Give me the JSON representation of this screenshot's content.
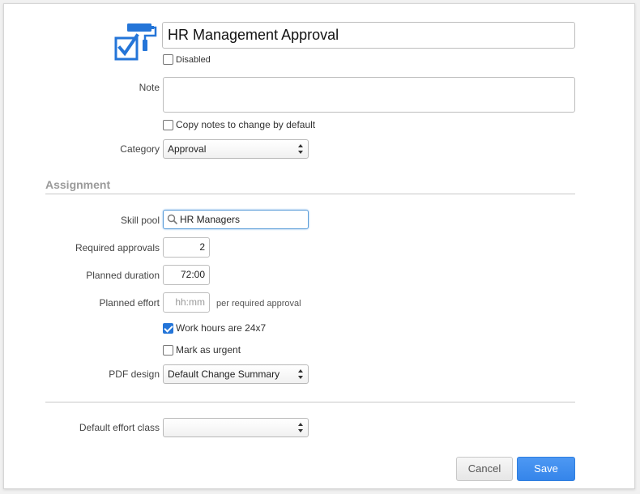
{
  "header": {
    "title_value": "HR Management Approval",
    "disabled_label": "Disabled"
  },
  "note": {
    "label": "Note",
    "value": "",
    "copy_label": "Copy notes to change by default"
  },
  "category": {
    "label": "Category",
    "value": "Approval"
  },
  "assignment": {
    "heading": "Assignment",
    "skill_pool_label": "Skill pool",
    "skill_pool_value": "HR Managers",
    "required_approvals_label": "Required approvals",
    "required_approvals_value": "2",
    "planned_duration_label": "Planned duration",
    "planned_duration_value": "72:00",
    "planned_effort_label": "Planned effort",
    "planned_effort_placeholder": "hh:mm",
    "planned_effort_suffix": "per required approval",
    "work_hours_label": "Work hours are 24x7",
    "work_hours_checked": true,
    "urgent_label": "Mark as urgent",
    "urgent_checked": false,
    "pdf_design_label": "PDF design",
    "pdf_design_value": "Default Change Summary"
  },
  "effort_class": {
    "label": "Default effort class",
    "value": ""
  },
  "buttons": {
    "cancel": "Cancel",
    "save": "Save"
  },
  "colors": {
    "accent": "#2475d8",
    "save_button": "#3f8ff0",
    "heading_gray": "#9a9a9a"
  },
  "icons": {
    "template": "paint-roller-checkbox-icon",
    "search": "search-icon"
  }
}
